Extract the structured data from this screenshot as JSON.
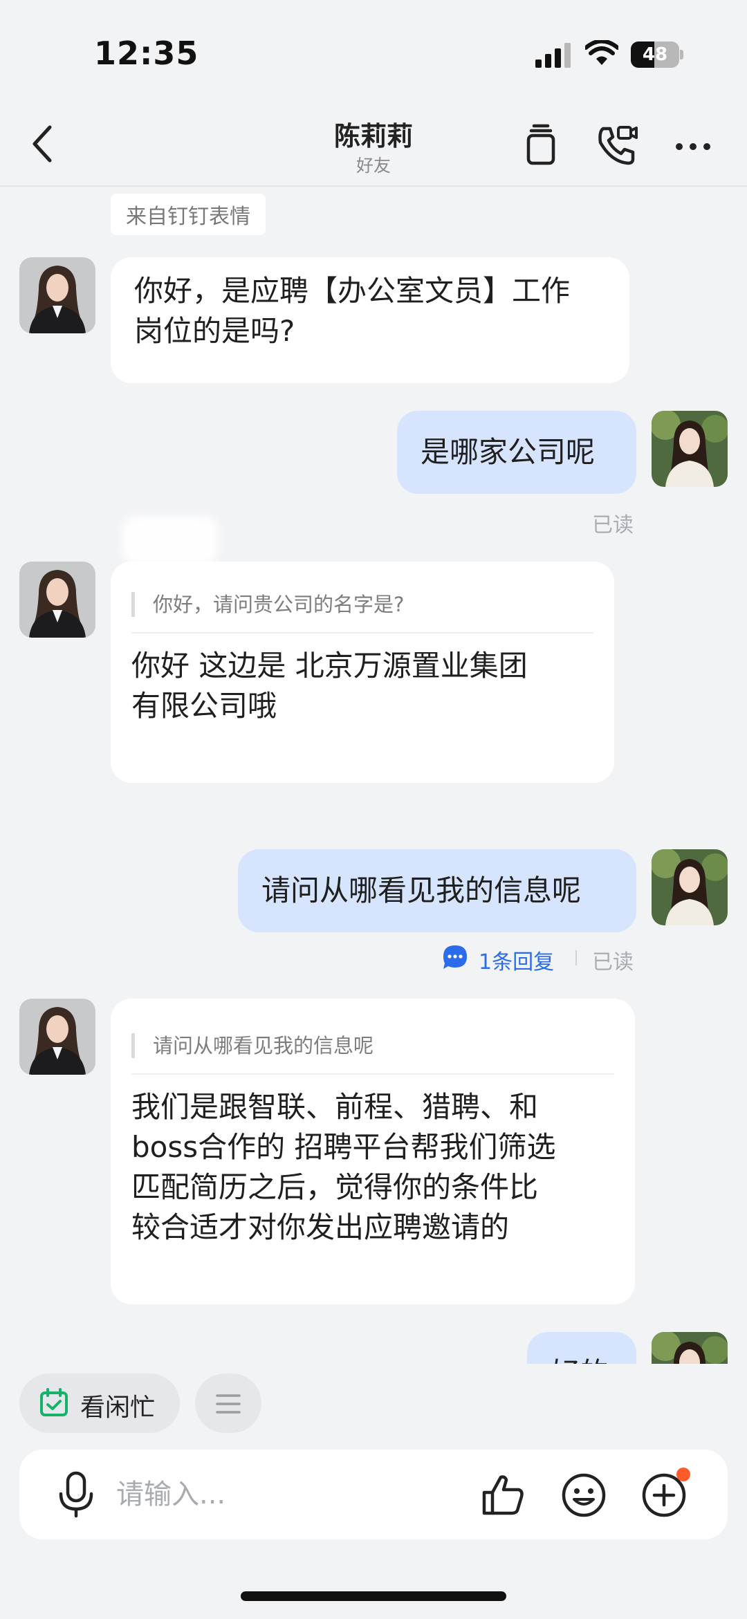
{
  "status_bar": {
    "time": "12:35",
    "battery": "48",
    "battery_level": 0.48
  },
  "header": {
    "title": "陈莉莉",
    "subtitle": "好友"
  },
  "messages": [
    {
      "tag": "来自钉钉表情"
    },
    {
      "side": "left",
      "text_line1": "你好，是应聘【办公室文员】工作",
      "text_line2": "岗位的是吗?"
    },
    {
      "side": "right",
      "text": "是哪家公司呢",
      "status": "已读"
    },
    {
      "side": "left",
      "quote": "你好，请问贵公司的名字是?",
      "text_line1": "你好  这边是  北京万源置业集团",
      "text_line2": "有限公司哦"
    },
    {
      "side": "right",
      "text": "请问从哪看见我的信息呢",
      "reply_count": "1条回复",
      "status": "已读"
    },
    {
      "side": "left",
      "quote": "请问从哪看见我的信息呢",
      "text_lines": [
        "我们是跟智联、前程、猎聘、和",
        "boss合作的 招聘平台帮我们筛选",
        "匹配简历之后，觉得你的条件比",
        "较合适才对你发出应聘邀请的"
      ]
    },
    {
      "side": "right",
      "text": "好的"
    }
  ],
  "quick_actions": {
    "free_busy": "看闲忙"
  },
  "composer": {
    "placeholder": "请输入..."
  },
  "colors": {
    "accent": "#2a6ce9",
    "bubble_right": "#d6e5fd",
    "bubble_left": "#ffffff",
    "background": "#f2f3f5",
    "badge": "#ff5a2a"
  }
}
